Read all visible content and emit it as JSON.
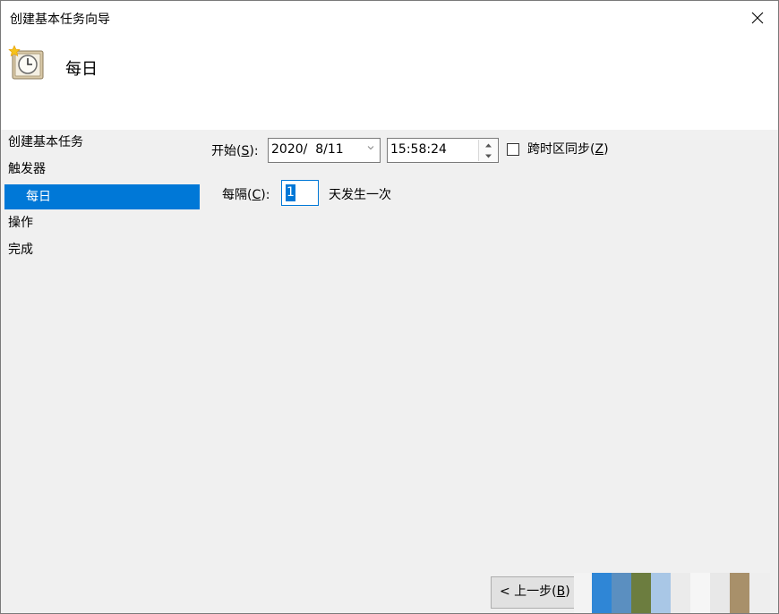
{
  "window": {
    "title": "创建基本任务向导"
  },
  "header": {
    "title": "每日"
  },
  "nav": {
    "items": [
      {
        "label": "创建基本任务"
      },
      {
        "label": "触发器"
      },
      {
        "label": "每日"
      },
      {
        "label": "操作"
      },
      {
        "label": "完成"
      }
    ]
  },
  "form": {
    "start_label": "开始(",
    "start_key": "S",
    "start_suffix": "):",
    "date_value": "2020/  8/11",
    "time_value": "15:58:24",
    "sync_label": "跨时区同步(",
    "sync_key": "Z",
    "sync_suffix": ")",
    "sync_checked": false,
    "interval_label": "每隔(",
    "interval_key": "C",
    "interval_suffix": "):",
    "interval_value": "1",
    "interval_unit": "天发生一次"
  },
  "buttons": {
    "back_label": "< 上一步(",
    "back_key": "B",
    "back_suffix": ")"
  },
  "colors": {
    "accent": "#0078d7",
    "body_bg": "#f0f0f0"
  },
  "icons": {
    "header": "task-clock-icon",
    "close": "close-icon",
    "spin_up": "spin-up-icon",
    "spin_down": "spin-down-icon",
    "dropdown": "chevron-down-icon"
  }
}
